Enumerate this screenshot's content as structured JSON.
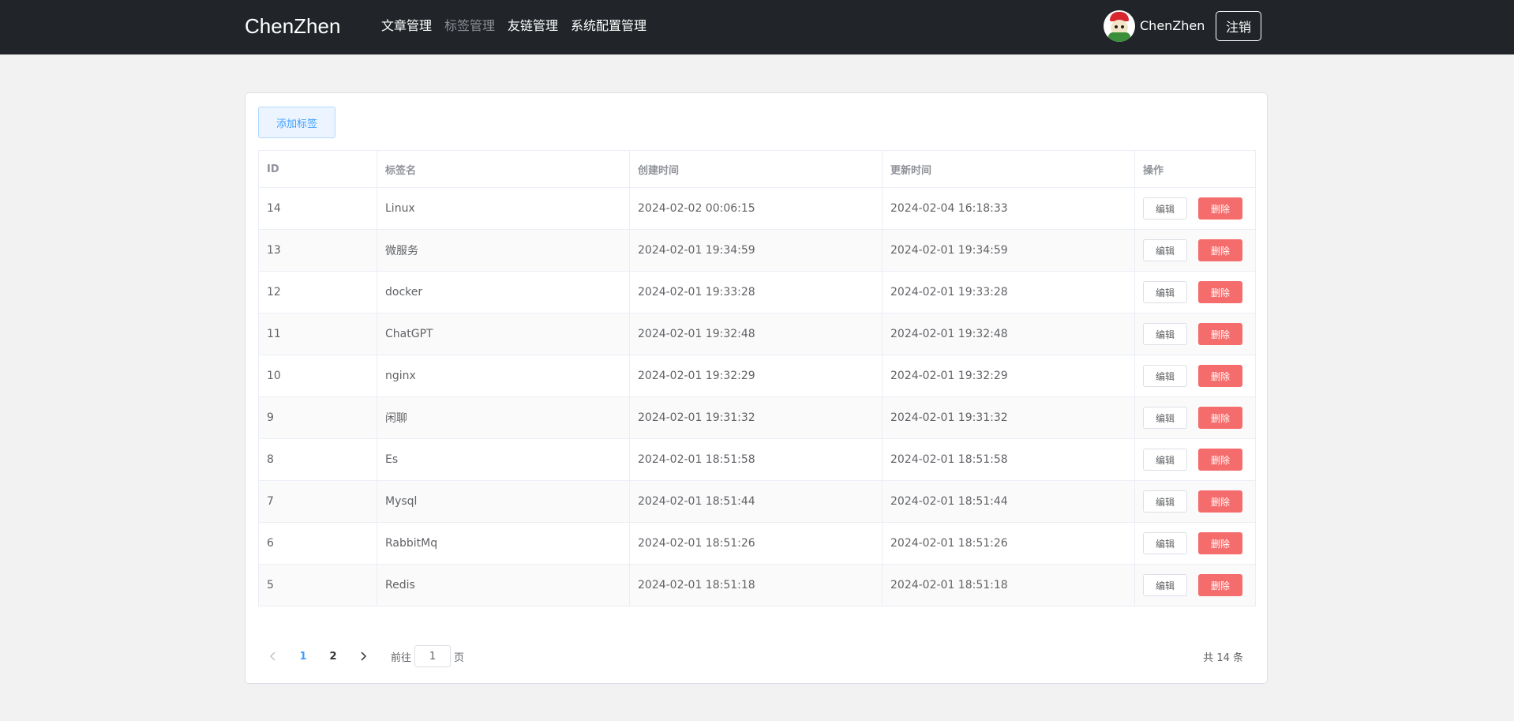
{
  "header": {
    "brand": "ChenZhen",
    "nav": [
      {
        "label": "文章管理",
        "active": false
      },
      {
        "label": "标签管理",
        "active": true
      },
      {
        "label": "友链管理",
        "active": false
      },
      {
        "label": "系统配置管理",
        "active": false
      }
    ],
    "username": "ChenZhen",
    "logout_label": "注销"
  },
  "toolbar": {
    "add_label": "添加标签"
  },
  "table": {
    "columns": [
      "ID",
      "标签名",
      "创建时间",
      "更新时间",
      "操作"
    ],
    "edit_label": "编辑",
    "delete_label": "删除",
    "rows": [
      {
        "id": "14",
        "name": "Linux",
        "created": "2024-02-02 00:06:15",
        "updated": "2024-02-04 16:18:33"
      },
      {
        "id": "13",
        "name": "微服务",
        "created": "2024-02-01 19:34:59",
        "updated": "2024-02-01 19:34:59"
      },
      {
        "id": "12",
        "name": "docker",
        "created": "2024-02-01 19:33:28",
        "updated": "2024-02-01 19:33:28"
      },
      {
        "id": "11",
        "name": "ChatGPT",
        "created": "2024-02-01 19:32:48",
        "updated": "2024-02-01 19:32:48"
      },
      {
        "id": "10",
        "name": "nginx",
        "created": "2024-02-01 19:32:29",
        "updated": "2024-02-01 19:32:29"
      },
      {
        "id": "9",
        "name": "闲聊",
        "created": "2024-02-01 19:31:32",
        "updated": "2024-02-01 19:31:32"
      },
      {
        "id": "8",
        "name": "Es",
        "created": "2024-02-01 18:51:58",
        "updated": "2024-02-01 18:51:58"
      },
      {
        "id": "7",
        "name": "Mysql",
        "created": "2024-02-01 18:51:44",
        "updated": "2024-02-01 18:51:44"
      },
      {
        "id": "6",
        "name": "RabbitMq",
        "created": "2024-02-01 18:51:26",
        "updated": "2024-02-01 18:51:26"
      },
      {
        "id": "5",
        "name": "Redis",
        "created": "2024-02-01 18:51:18",
        "updated": "2024-02-01 18:51:18"
      }
    ]
  },
  "pagination": {
    "prev_icon": "chevron-left-icon",
    "next_icon": "chevron-right-icon",
    "pages": [
      "1",
      "2"
    ],
    "current_page": "1",
    "goto_prefix": "前往",
    "goto_value": "1",
    "goto_suffix": "页",
    "total": "共 14 条"
  },
  "colors": {
    "nav_bg": "#212529",
    "primary": "#409eff",
    "danger": "#f56c6c",
    "page_bg": "#f2f2f2"
  }
}
